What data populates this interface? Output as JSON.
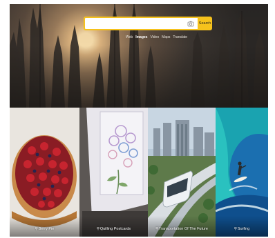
{
  "search": {
    "value": "",
    "placeholder": "",
    "button_label": "Search"
  },
  "nav": {
    "items": [
      {
        "label": "Web",
        "active": false
      },
      {
        "label": "Images",
        "active": true
      },
      {
        "label": "Video",
        "active": false
      },
      {
        "label": "Maps",
        "active": false
      },
      {
        "label": "Translate",
        "active": false
      }
    ]
  },
  "cards": [
    {
      "label": "Berry Pie"
    },
    {
      "label": "Quilling Postcards"
    },
    {
      "label": "Transportation Of The Future"
    },
    {
      "label": "Surfing"
    }
  ],
  "colors": {
    "accent": "#f6c21c",
    "hero_dark": "#2a2725",
    "sun_glow": "#f3d9a8"
  },
  "icons": {
    "camera": "camera-icon",
    "search_prefix": "search-icon"
  }
}
